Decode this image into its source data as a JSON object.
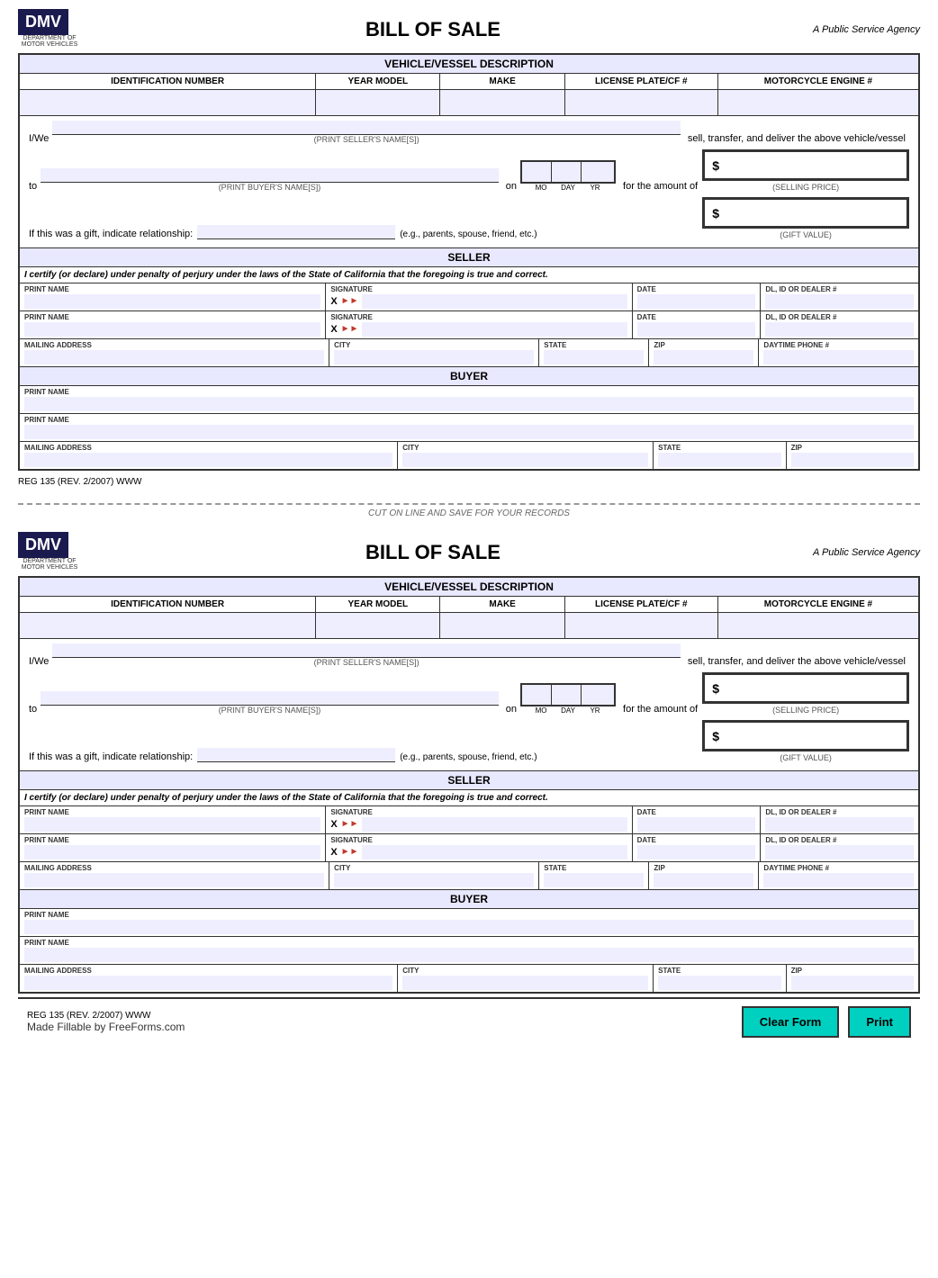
{
  "page": {
    "title": "BILL OF SALE",
    "agency": "A Public Service Agency",
    "cut_line_text": "CUT ON LINE AND SAVE FOR YOUR RECORDS",
    "reg_line": "REG 135 (REV. 2/2007) WWW",
    "made_by": "Made Fillable by FreeForms.com"
  },
  "buttons": {
    "clear": "Clear Form",
    "print": "Print"
  },
  "form": {
    "vehicle_description_title": "VEHICLE/VESSEL DESCRIPTION",
    "headers": {
      "id_number": "IDENTIFICATION NUMBER",
      "year_model": "YEAR MODEL",
      "make": "MAKE",
      "license_plate": "LICENSE PLATE/CF #",
      "moto_engine": "MOTORCYCLE ENGINE #"
    },
    "iwe_prefix": "I/We",
    "iwe_suffix": "sell, transfer, and deliver the above vehicle/vessel",
    "seller_name_label": "(PRINT SELLER'S NAME[S])",
    "to_prefix": "to",
    "on_text": "on",
    "for_amount": "for  the amount of",
    "selling_price_label": "(SELLING PRICE)",
    "gift_prefix": "If this was a gift, indicate relationship:",
    "gift_hint": "(e.g., parents, spouse, friend, etc.)",
    "gift_value_label": "(GIFT VALUE)",
    "buyer_name_label": "(PRINT BUYER'S NAME[S])",
    "date_labels": [
      "MO",
      "DAY",
      "YR"
    ],
    "dollar_sign": "$",
    "seller_title": "SELLER",
    "certify_text": "I certify (or declare) under penalty of perjury under the laws of the State of California that the foregoing is true and correct.",
    "field_labels": {
      "print_name": "PRINT NAME",
      "signature": "SIGNATURE",
      "date": "DATE",
      "dl_id": "DL, ID OR DEALER #",
      "mailing_address": "MAILING ADDRESS",
      "city": "CITY",
      "state": "STATE",
      "zip": "ZIP",
      "daytime_phone": "DAYTIME PHONE #"
    },
    "sig_x": "X",
    "buyer_title": "BUYER"
  }
}
